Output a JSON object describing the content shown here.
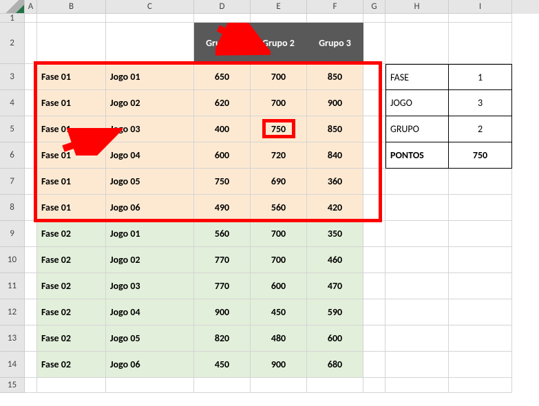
{
  "columns": [
    "A",
    "B",
    "C",
    "D",
    "E",
    "F",
    "G",
    "H",
    "I"
  ],
  "headerRow": {
    "d": "Grupo 1",
    "e": "Grupo 2",
    "f": "Grupo 3"
  },
  "rows": [
    {
      "num": 3,
      "fase": "Fase 01",
      "jogo": "Jogo 01",
      "d": "650",
      "e": "700",
      "f": "850",
      "cls": "fase1bg"
    },
    {
      "num": 4,
      "fase": "Fase 01",
      "jogo": "Jogo 02",
      "d": "620",
      "e": "700",
      "f": "900",
      "cls": "fase1bg"
    },
    {
      "num": 5,
      "fase": "Fase 01",
      "jogo": "Jogo 03",
      "d": "400",
      "e": "750",
      "f": "850",
      "cls": "fase1bg"
    },
    {
      "num": 6,
      "fase": "Fase 01",
      "jogo": "Jogo 04",
      "d": "600",
      "e": "720",
      "f": "840",
      "cls": "fase1bg"
    },
    {
      "num": 7,
      "fase": "Fase 01",
      "jogo": "Jogo 05",
      "d": "750",
      "e": "690",
      "f": "360",
      "cls": "fase1bg"
    },
    {
      "num": 8,
      "fase": "Fase 01",
      "jogo": "Jogo 06",
      "d": "490",
      "e": "560",
      "f": "420",
      "cls": "fase1bg"
    },
    {
      "num": 9,
      "fase": "Fase 02",
      "jogo": "Jogo 01",
      "d": "560",
      "e": "700",
      "f": "350",
      "cls": "fase2bg"
    },
    {
      "num": 10,
      "fase": "Fase 02",
      "jogo": "Jogo 02",
      "d": "770",
      "e": "700",
      "f": "460",
      "cls": "fase2bg"
    },
    {
      "num": 11,
      "fase": "Fase 02",
      "jogo": "Jogo 03",
      "d": "770",
      "e": "600",
      "f": "470",
      "cls": "fase2bg"
    },
    {
      "num": 12,
      "fase": "Fase 02",
      "jogo": "Jogo 04",
      "d": "900",
      "e": "450",
      "f": "590",
      "cls": "fase2bg"
    },
    {
      "num": 13,
      "fase": "Fase 02",
      "jogo": "Jogo 05",
      "d": "820",
      "e": "480",
      "f": "600",
      "cls": "fase2bg"
    },
    {
      "num": 14,
      "fase": "Fase 02",
      "jogo": "Jogo 06",
      "d": "450",
      "e": "900",
      "f": "680",
      "cls": "fase2bg"
    }
  ],
  "lookup": {
    "fase_label": "FASE",
    "fase_val": "1",
    "jogo_label": "JOGO",
    "jogo_val": "3",
    "grupo_label": "GRUPO",
    "grupo_val": "2",
    "pontos_label": "PONTOS",
    "pontos_val": "750"
  },
  "rowLabels": {
    "r1": "1",
    "r2": "2",
    "r15": "15"
  }
}
